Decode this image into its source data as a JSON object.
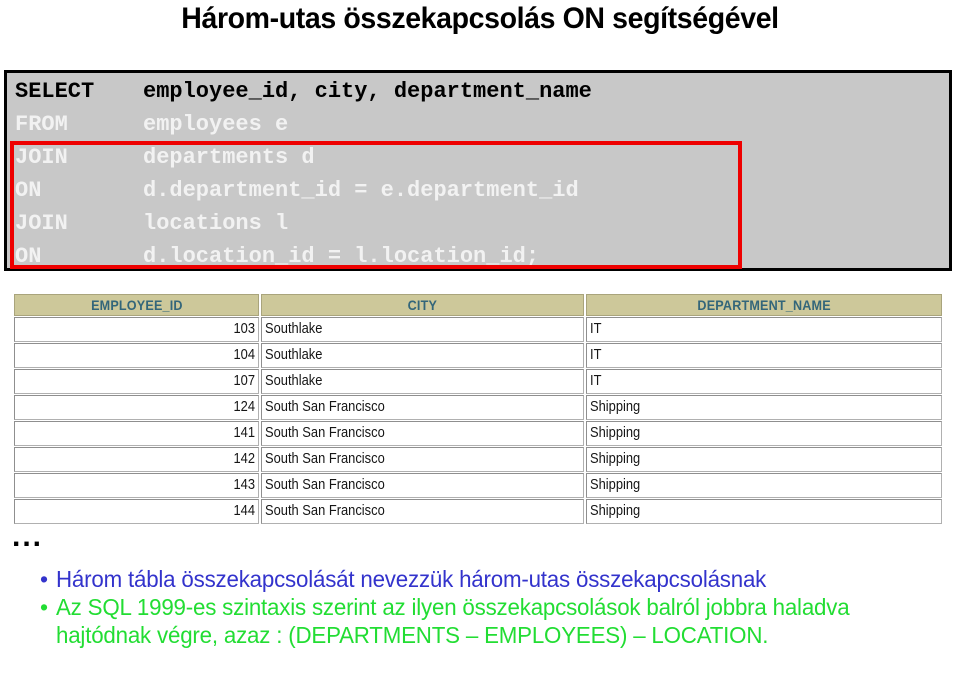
{
  "slide": {
    "title": "Három-utas összekapcsolás ON segítségével",
    "ellipsis": "..."
  },
  "sql": {
    "lines": [
      {
        "keyword": "SELECT",
        "rest": "employee_id, city, department_name",
        "highlighted": false,
        "style": "black"
      },
      {
        "keyword": "FROM",
        "rest": "employees e",
        "highlighted": false,
        "style": "white"
      },
      {
        "keyword": "JOIN",
        "rest": "departments d",
        "highlighted": true,
        "style": "white"
      },
      {
        "keyword": "ON",
        "rest": "d.department_id = e.department_id",
        "highlighted": true,
        "style": "white"
      },
      {
        "keyword": "JOIN",
        "rest": "locations l",
        "highlighted": true,
        "style": "white"
      },
      {
        "keyword": "ON",
        "rest": "d.location_id = l.location_id;",
        "highlighted": true,
        "style": "white"
      }
    ],
    "highlight_color": "#ee0000",
    "panel_background": "#c8c8c8",
    "panel_border_color": "#000000"
  },
  "result_grid": {
    "columns": [
      "EMPLOYEE_ID",
      "CITY",
      "DEPARTMENT_NAME"
    ],
    "header_background": "#cdc89a",
    "header_text_color": "#33667a",
    "rows": [
      [
        "103",
        "Southlake",
        "IT"
      ],
      [
        "104",
        "Southlake",
        "IT"
      ],
      [
        "107",
        "Southlake",
        "IT"
      ],
      [
        "124",
        "South San Francisco",
        "Shipping"
      ],
      [
        "141",
        "South San Francisco",
        "Shipping"
      ],
      [
        "142",
        "South San Francisco",
        "Shipping"
      ],
      [
        "143",
        "South San Francisco",
        "Shipping"
      ],
      [
        "144",
        "South San Francisco",
        "Shipping"
      ]
    ]
  },
  "bullets": [
    {
      "marker": "•",
      "text": "Három tábla összekapcsolását nevezzük három-utas összekapcsolásnak",
      "color": "#3333cc"
    },
    {
      "marker": "•",
      "text": "Az SQL 1999-es szintaxis szerint az ilyen összekapcsolások balról jobbra haladva hajtódnak végre, azaz : (DEPARTMENTS – EMPLOYEES) – LOCATION.",
      "color": "#22dd33"
    }
  ]
}
